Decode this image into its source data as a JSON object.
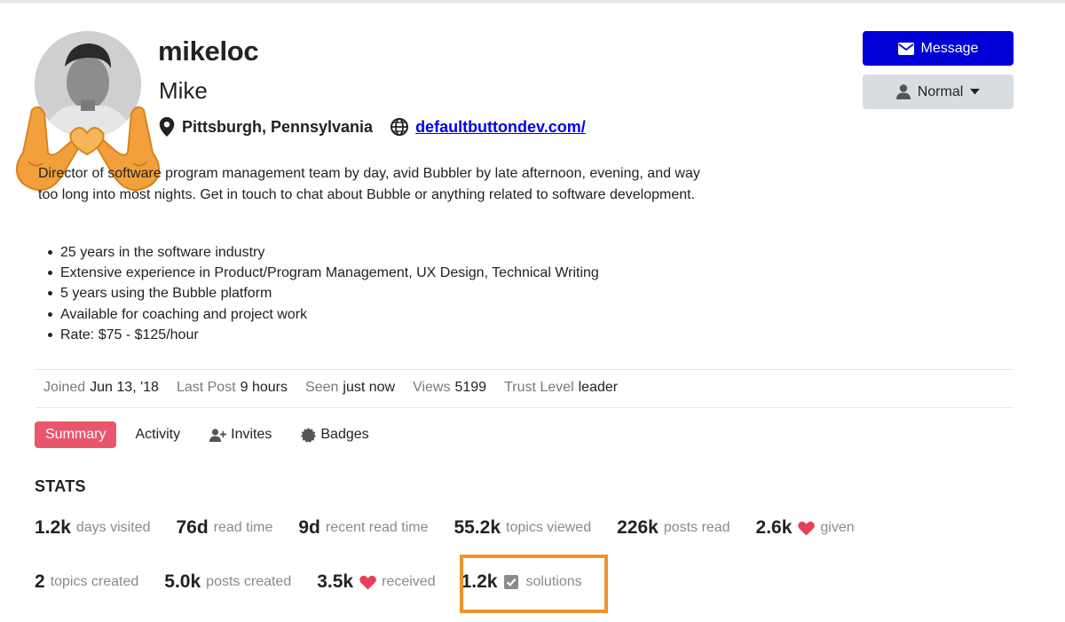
{
  "profile": {
    "username": "mikeloc",
    "full_name": "Mike",
    "location": "Pittsburgh, Pennsylvania",
    "website": "defaultbuttondev.com/",
    "bio": "Director of software program management team by day, avid Bubbler by late afternoon, evening, and way too long into most nights. Get in touch to chat about Bubble or anything related to software development.",
    "bullets": [
      "25 years in the software industry",
      "Extensive experience in Product/Program Management, UX Design, Technical Writing",
      "5 years using the Bubble platform",
      "Available for coaching and project work",
      "Rate: $75 - $125/hour"
    ]
  },
  "actions": {
    "message_label": "Message",
    "notification_label": "Normal"
  },
  "meta": [
    {
      "label": "Joined",
      "value": "Jun 13, '18"
    },
    {
      "label": "Last Post",
      "value": "9 hours"
    },
    {
      "label": "Seen",
      "value": "just now"
    },
    {
      "label": "Views",
      "value": "5199"
    },
    {
      "label": "Trust Level",
      "value": "leader"
    }
  ],
  "tabs": [
    {
      "label": "Summary",
      "icon": "",
      "active": true
    },
    {
      "label": "Activity",
      "icon": "",
      "active": false
    },
    {
      "label": "Invites",
      "icon": "user-plus-icon",
      "active": false
    },
    {
      "label": "Badges",
      "icon": "badge-icon",
      "active": false
    }
  ],
  "stats": {
    "title": "STATS",
    "row1": [
      {
        "num": "1.2k",
        "label": "days visited"
      },
      {
        "num": "76d",
        "label": "read time"
      },
      {
        "num": "9d",
        "label": "recent read time"
      },
      {
        "num": "55.2k",
        "label": "topics viewed"
      },
      {
        "num": "226k",
        "label": "posts read"
      },
      {
        "num": "2.6k",
        "label": "given",
        "icon": "heart-icon"
      }
    ],
    "row2": [
      {
        "num": "2",
        "label": "topics created"
      },
      {
        "num": "5.0k",
        "label": "posts created"
      },
      {
        "num": "3.5k",
        "label": "received",
        "icon": "heart-icon"
      },
      {
        "num": "1.2k",
        "label": "solutions",
        "icon": "check-square-icon"
      }
    ]
  },
  "colors": {
    "message_button": "#0000d6",
    "active_tab": "#e8576e",
    "heart": "#e8405a",
    "highlight_box": "#f1932c",
    "link": "#0000ee"
  }
}
